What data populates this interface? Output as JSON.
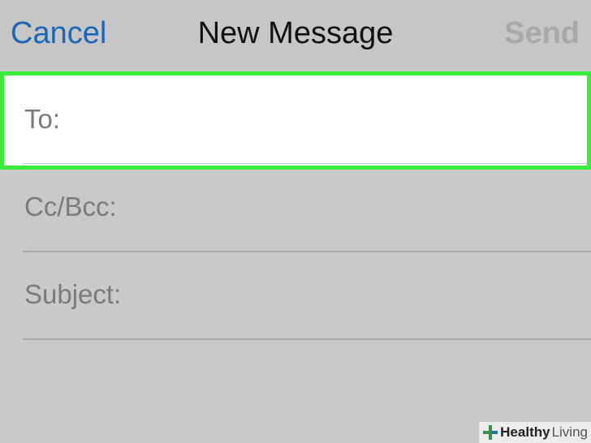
{
  "navbar": {
    "cancel_label": "Cancel",
    "title": "New Message",
    "send_label": "Send"
  },
  "fields": {
    "to": {
      "label": "To:",
      "value": ""
    },
    "cc_bcc": {
      "label": "Cc/Bcc:",
      "value": ""
    },
    "subject": {
      "label": "Subject:",
      "value": ""
    }
  },
  "colors": {
    "accent": "#1a67b9",
    "highlight": "#3cec3c",
    "disabled": "#a9a9a9",
    "background": "#c9c9c9"
  },
  "watermark": {
    "icon": "plus-cross-icon",
    "bold_text": "Healthy",
    "light_text": "Living"
  }
}
